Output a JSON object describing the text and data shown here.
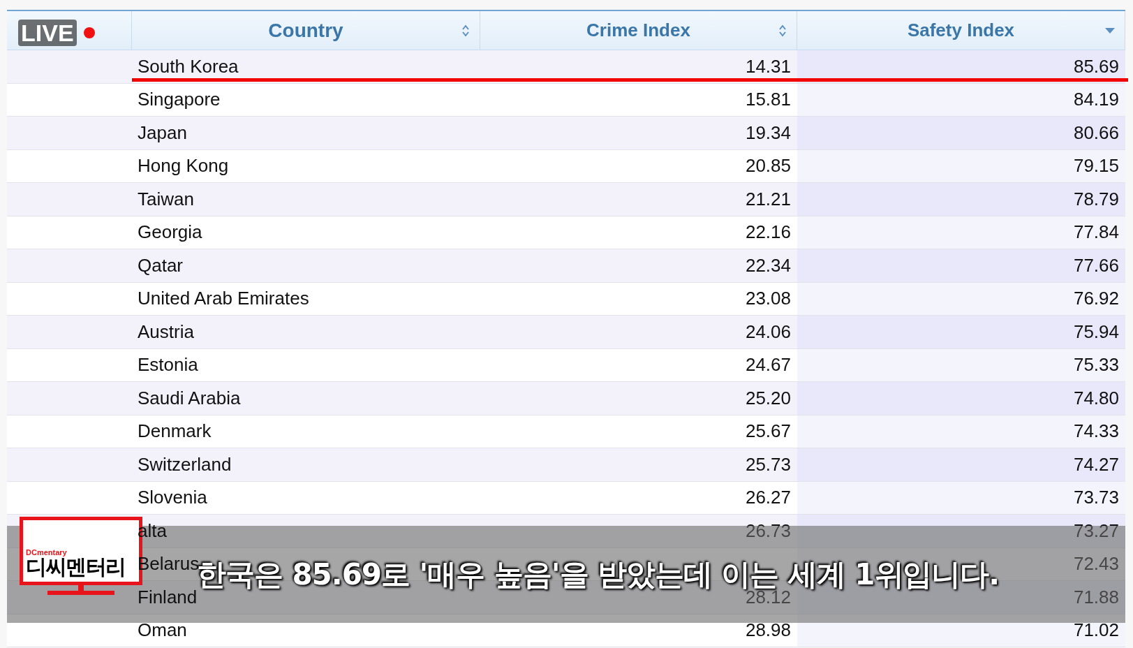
{
  "live_badge": {
    "label": "LIVE"
  },
  "table": {
    "columns": [
      {
        "label": "Country",
        "sorted": false
      },
      {
        "label": "Crime Index",
        "sorted": false
      },
      {
        "label": "Safety Index",
        "sorted": true
      }
    ],
    "rows": [
      {
        "country": "South Korea",
        "crime_index": "14.31",
        "safety_index": "85.69",
        "underlined": true
      },
      {
        "country": "Singapore",
        "crime_index": "15.81",
        "safety_index": "84.19",
        "underlined": false
      },
      {
        "country": "Japan",
        "crime_index": "19.34",
        "safety_index": "80.66",
        "underlined": false
      },
      {
        "country": "Hong Kong",
        "crime_index": "20.85",
        "safety_index": "79.15",
        "underlined": false
      },
      {
        "country": "Taiwan",
        "crime_index": "21.21",
        "safety_index": "78.79",
        "underlined": false
      },
      {
        "country": "Georgia",
        "crime_index": "22.16",
        "safety_index": "77.84",
        "underlined": false
      },
      {
        "country": "Qatar",
        "crime_index": "22.34",
        "safety_index": "77.66",
        "underlined": false
      },
      {
        "country": "United Arab Emirates",
        "crime_index": "23.08",
        "safety_index": "76.92",
        "underlined": false
      },
      {
        "country": "Austria",
        "crime_index": "24.06",
        "safety_index": "75.94",
        "underlined": false
      },
      {
        "country": "Estonia",
        "crime_index": "24.67",
        "safety_index": "75.33",
        "underlined": false
      },
      {
        "country": "Saudi Arabia",
        "crime_index": "25.20",
        "safety_index": "74.80",
        "underlined": false
      },
      {
        "country": "Denmark",
        "crime_index": "25.67",
        "safety_index": "74.33",
        "underlined": false
      },
      {
        "country": "Switzerland",
        "crime_index": "25.73",
        "safety_index": "74.27",
        "underlined": false
      },
      {
        "country": "Slovenia",
        "crime_index": "26.27",
        "safety_index": "73.73",
        "underlined": false
      },
      {
        "country": "alta",
        "crime_index": "26.73",
        "safety_index": "73.27",
        "underlined": false
      },
      {
        "country": "Belarus",
        "safety_index": "72.43",
        "underlined": false
      },
      {
        "country": "Finland",
        "crime_index": "28.12",
        "safety_index": "71.88",
        "underlined": false
      },
      {
        "country": "Oman",
        "crime_index": "28.98",
        "safety_index": "71.02",
        "underlined": false
      }
    ]
  },
  "logo": {
    "small_text": "DCmentary",
    "title": "디씨멘터리"
  },
  "caption": "한국은 85.69로 '매우 높음'을 받았는데 이는 세계 1위입니다."
}
